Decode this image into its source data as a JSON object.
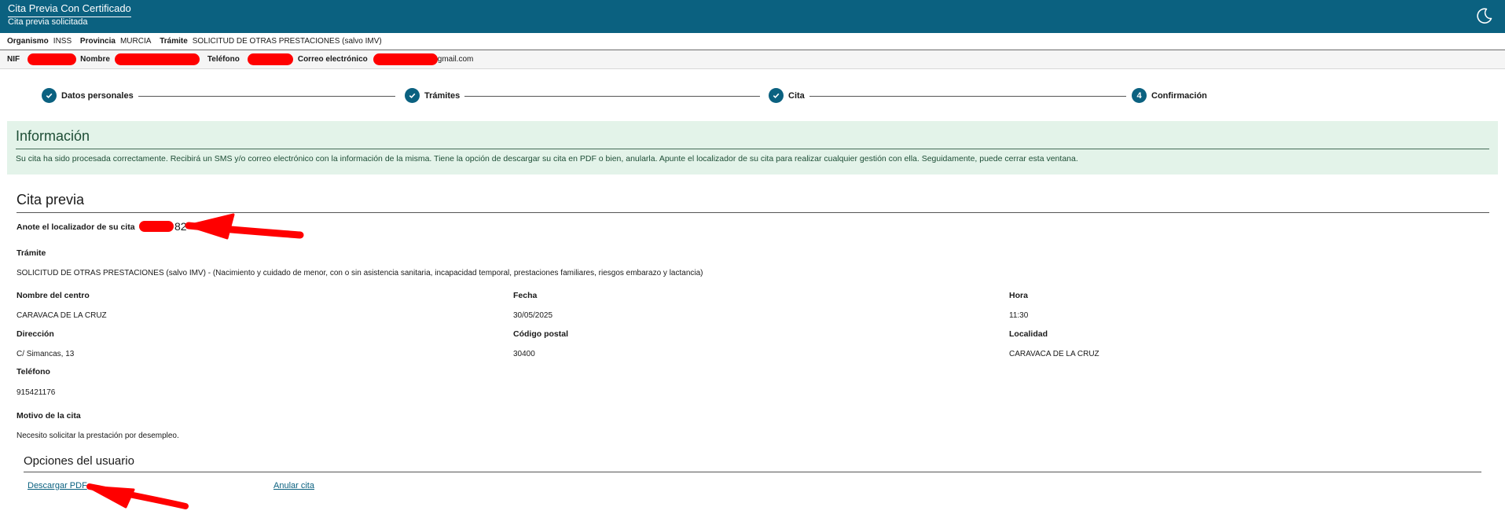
{
  "header": {
    "title": "Cita Previa Con Certificado",
    "subtitle": "Cita previa solicitada",
    "theme_icon": "moon-icon"
  },
  "summary": {
    "organismo_label": "Organismo",
    "organismo_value": "INSS",
    "provincia_label": "Provincia",
    "provincia_value": "MURCIA",
    "tramite_label": "Trámite",
    "tramite_value": "SOLICITUD DE OTRAS PRESTACIONES (salvo IMV)"
  },
  "user": {
    "nif_label": "NIF",
    "nombre_label": "Nombre",
    "telefono_label": "Teléfono",
    "correo_label": "Correo electrónico",
    "correo_suffix": "gmail.com"
  },
  "steps": [
    {
      "label": "Datos personales",
      "state": "done"
    },
    {
      "label": "Trámites",
      "state": "done"
    },
    {
      "label": "Cita",
      "state": "done"
    },
    {
      "label": "Confirmación",
      "state": "current",
      "number": "4"
    }
  ],
  "info": {
    "title": "Información",
    "text": "Su cita ha sido procesada correctamente. Recibirá un SMS y/o correo electrónico con la información de la misma. Tiene la opción de descargar su cita en PDF o bien, anularla. Apunte el localizador de su cita para realizar cualquier gestión con ella. Seguidamente, puede cerrar esta ventana."
  },
  "cita": {
    "section_title": "Cita previa",
    "localizador_label": "Anote el localizador de su cita",
    "localizador_visible": "82",
    "tramite_label": "Trámite",
    "tramite_value": "SOLICITUD DE OTRAS PRESTACIONES (salvo IMV) - (Nacimiento y cuidado de menor, con o sin asistencia sanitaria, incapacidad temporal, prestaciones familiares, riesgos embarazo y lactancia)",
    "centro_label": "Nombre del centro",
    "centro_value": "CARAVACA DE LA CRUZ",
    "fecha_label": "Fecha",
    "fecha_value": "30/05/2025",
    "hora_label": "Hora",
    "hora_value": "11:30",
    "direccion_label": "Dirección",
    "direccion_value": "C/ Simancas, 13",
    "cp_label": "Código postal",
    "cp_value": "30400",
    "localidad_label": "Localidad",
    "localidad_value": "CARAVACA DE LA CRUZ",
    "telefono_label": "Teléfono",
    "telefono_value": "915421176",
    "motivo_label": "Motivo de la cita",
    "motivo_value": "Necesito solicitar la prestación por desempleo."
  },
  "options": {
    "title": "Opciones del usuario",
    "download_label": "Descargar PDF",
    "cancel_label": "Anular cita"
  },
  "annotations": {
    "redaction_color": "#ff0000",
    "arrow_color": "#ff0000"
  }
}
